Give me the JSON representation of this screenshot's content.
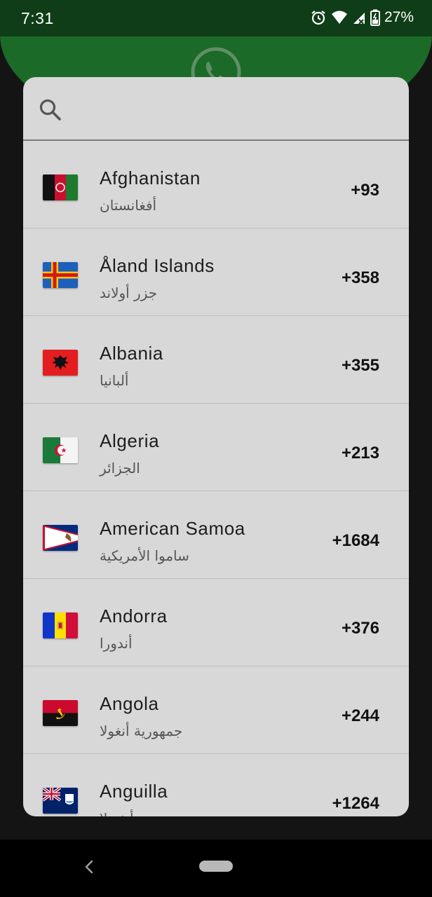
{
  "status_bar": {
    "time": "7:31",
    "battery": "27%",
    "icons": [
      "alarm-icon",
      "wifi-icon",
      "cell-signal-icon",
      "battery-icon"
    ]
  },
  "search": {
    "placeholder": "",
    "value": ""
  },
  "countries": [
    {
      "name": "Afghanistan",
      "local": "أفغانستان",
      "code": "+93",
      "flag": "af"
    },
    {
      "name": "Åland Islands",
      "local": "جزر أولاند",
      "code": "+358",
      "flag": "ax"
    },
    {
      "name": "Albania",
      "local": "ألبانيا",
      "code": "+355",
      "flag": "al"
    },
    {
      "name": "Algeria",
      "local": "الجزائر",
      "code": "+213",
      "flag": "dz"
    },
    {
      "name": "American Samoa",
      "local": "ساموا الأمريكية",
      "code": "+1684",
      "flag": "as"
    },
    {
      "name": "Andorra",
      "local": "أندورا",
      "code": "+376",
      "flag": "ad"
    },
    {
      "name": "Angola",
      "local": "جمهورية أنغولا",
      "code": "+244",
      "flag": "ao"
    },
    {
      "name": "Anguilla",
      "local": "أنغويلا",
      "code": "+1264",
      "flag": "ai"
    }
  ],
  "colors": {
    "header_green": "#1b6a27",
    "status_green": "#0f3d17",
    "dialog_bg": "#d8d8d8"
  }
}
